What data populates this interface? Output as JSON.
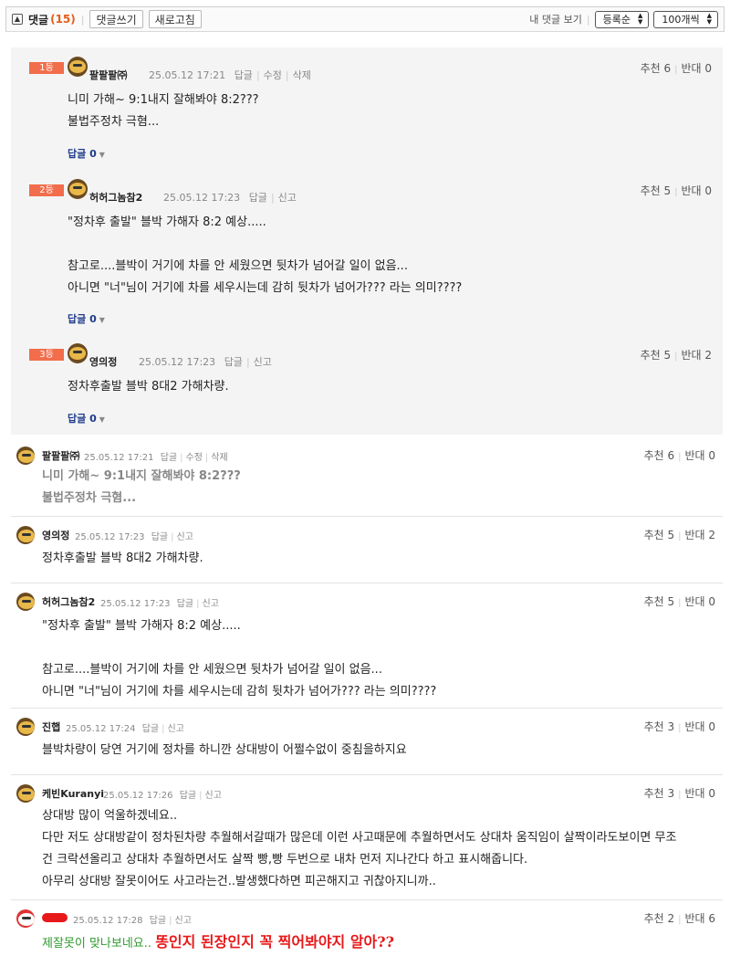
{
  "toolbar": {
    "toggle_icon": "collapse-icon",
    "title": "댓글",
    "count": "(15)",
    "write_btn": "댓글쓰기",
    "refresh_btn": "새로고침",
    "my_comments": "내 댓글 보기",
    "sort_select": "등록순",
    "per_page_select": "100개씩"
  },
  "best": [
    {
      "rank": "1등",
      "nick": "팔팔팔㈜",
      "time": "25.05.12 17:21",
      "actions": [
        "답글",
        "수정",
        "삭제"
      ],
      "up": "추천 6",
      "down": "반대 0",
      "lines": [
        "니미 가해~ 9:1내지 잘해봐야 8:2???",
        "불법주정차 극혐..."
      ],
      "reply": "답글 0"
    },
    {
      "rank": "2등",
      "nick": "허허그놈참2",
      "time": "25.05.12 17:23",
      "actions": [
        "답글",
        "신고"
      ],
      "up": "추천 5",
      "down": "반대 0",
      "lines": [
        "\"정차후 출발\" 블박 가해자 8:2 예상.....",
        "",
        "참고로....블박이 거기에 차를 안 세웠으면 뒷차가 넘어갈 일이 없음...",
        "아니면 \"너\"님이 거기에 차를 세우시는데 감히 뒷차가 넘어가??? 라는 의미????"
      ],
      "reply": "답글 0"
    },
    {
      "rank": "3등",
      "nick": "영의정",
      "time": "25.05.12 17:23",
      "actions": [
        "답글",
        "신고"
      ],
      "up": "추천 5",
      "down": "반대 2",
      "lines": [
        "정차후출발 블박 8대2 가해차량."
      ],
      "reply": "답글 0"
    }
  ],
  "comments": [
    {
      "nick": "팔팔팔㈜",
      "time": "25.05.12 17:21",
      "actions": [
        "답글",
        "수정",
        "삭제"
      ],
      "up": "추천 6",
      "down": "반대 0",
      "lines": [
        "니미 가해~ 9:1내지 잘해봐야 8:2???",
        "불법주정차 극혐..."
      ]
    },
    {
      "nick": "영의정",
      "time": "25.05.12 17:23",
      "actions": [
        "답글",
        "신고"
      ],
      "up": "추천 5",
      "down": "반대 2",
      "lines": [
        "정차후출발 블박 8대2 가해차량."
      ]
    },
    {
      "nick": "허허그놈참2",
      "time": "25.05.12 17:23",
      "actions": [
        "답글",
        "신고"
      ],
      "up": "추천 5",
      "down": "반대 0",
      "lines": [
        "\"정차후 출발\" 블박 가해자 8:2 예상.....",
        "",
        "참고로....블박이 거기에 차를 안 세웠으면 뒷차가 넘어갈 일이 없음...",
        "아니면 \"너\"님이 거기에 차를 세우시는데 감히 뒷차가 넘어가??? 라는 의미????"
      ]
    },
    {
      "nick": "진햅",
      "time": "25.05.12 17:24",
      "actions": [
        "답글",
        "신고"
      ],
      "up": "추천 3",
      "down": "반대 0",
      "lines": [
        "블박차량이 당연 거기에 정차를 하니깐 상대방이 어쩔수없이 중침을하지요"
      ]
    },
    {
      "nick": "케빈Kuranyi",
      "time": "25.05.12 17:26",
      "actions": [
        "답글",
        "신고"
      ],
      "up": "추천 3",
      "down": "반대 0",
      "lines": [
        "상대방 많이 억울하겠네요..",
        "다만 저도 상대방같이 정차된차량 추월해서갈때가 많은데 이런 사고때문에 추월하면서도 상대차 움직임이 살짝이라도보이면 무조",
        "건 크락션올리고 상대차 추월하면서도 살짝 빵,빵 두번으로 내차 먼저 지나간다 하고 표시해줍니다.",
        "아무리 상대방 잘못이어도 사고라는건..발생했다하면 피곤해지고 귀찮아지니까.."
      ]
    },
    {
      "nick": "",
      "time": "25.05.12 17:28",
      "actions": [
        "답글",
        "신고"
      ],
      "up": "추천 2",
      "down": "반대 6",
      "line_green": "제잘못이 맞나보네요..",
      "line_red": "똥인지 된장인지 꼭 찍어봐야지 알아??"
    }
  ]
}
